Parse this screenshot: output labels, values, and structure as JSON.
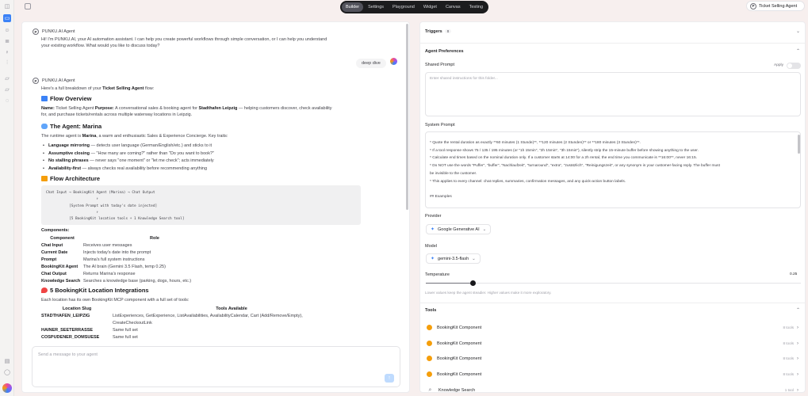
{
  "rail": {
    "icons": [
      "panel-left-icon",
      "message-icon",
      "bot-icon",
      "database-icon",
      "bulb-icon",
      "chart-icon",
      "folder-icon",
      "folder-icon",
      "bell-icon",
      "settings-icon",
      "book-icon",
      "chat-icon"
    ]
  },
  "topbar": {
    "tabs": [
      "Builder",
      "Settings",
      "Playground",
      "Widget",
      "Canvas",
      "Testing"
    ],
    "active_tab": "Builder",
    "agent_name": "Ticket Selling Agent"
  },
  "chat": {
    "sender": "PUNKU.AI Agent",
    "greeting_lines": [
      "Hi! I'm PUNKU.AI, your AI automation assistant. I can help you create powerful workflows through simple conversation, or I can help you understand",
      "your existing workflow. What would you like to discuss today?"
    ],
    "user_message": "deep dive",
    "breakdown_intro_pre": "Here's a full breakdown of your ",
    "breakdown_intro_bold": "Ticket Selling Agent",
    "breakdown_intro_post": " flow:",
    "overview_heading": "Flow Overview",
    "name_label": "Name:",
    "name_value": " Ticket Selling Agent ",
    "purpose_label": "Purpose:",
    "purpose_value_pre": " A conversational sales & booking agent for ",
    "purpose_bold": "Stadthafen Leipzig",
    "purpose_value_post": " — helping customers discover, check availability",
    "purpose_line2": "for, and purchase tickets/rentals across multiple waterway locations in Leipzig.",
    "agent_heading": "The Agent: Marina",
    "agent_desc_pre": "The runtime agent is ",
    "agent_desc_bold": "Marina",
    "agent_desc_post": ", a warm and enthusiastic Sales & Experience Concierge. Key traits:",
    "traits": [
      {
        "bold": "Language mirroring",
        "text": " — detects user language (German/English/etc.) and sticks to it"
      },
      {
        "bold": "Assumptive closing",
        "text": " — \"How many are coming?\" rather than \"Do you want to book?\""
      },
      {
        "bold": "No stalling phrases",
        "text": " — never says \"one moment\" or \"let me check\"; acts immediately"
      },
      {
        "bold": "Availability-first",
        "text": " — always checks real availability before recommending anything"
      }
    ],
    "arch_heading": "Flow Architecture",
    "arch_code": [
      "Chat Input → BookingKit Agent (Marina) → Chat Output",
      "                        ↑",
      "           [System Prompt with today's date injected]",
      "                        ↑",
      "           [5 BookingKit location tools + 1 Knowledge Search tool]"
    ],
    "components_label": "Components:",
    "components_headers": [
      "Component",
      "Role"
    ],
    "components": [
      [
        "Chat Input",
        "Receives user messages"
      ],
      [
        "Current Date",
        "Injects today's date into the prompt"
      ],
      [
        "Prompt",
        "Marina's full system instructions"
      ],
      [
        "BookingKit Agent",
        "The AI brain (Gemini 3.5 Flash, temp 0.25)"
      ],
      [
        "Chat Output",
        "Returns Marina's response"
      ],
      [
        "Knowledge Search",
        "Searches a knowledge base (parking, dogs, hours, etc.)"
      ]
    ],
    "locations_heading": "5 BookingKit Location Integrations",
    "locations_intro": "Each location has its own BookingKit MCP component with a full set of tools:",
    "locations_headers": [
      "Location Slug",
      "Tools Available"
    ],
    "locations": [
      [
        "STADTHAFEN_LEIPZIG",
        "ListExperiences, GetExperience, ListAvailabilities, AvailabilityCalendar, Cart (Add/Remove/Empty),"
      ],
      [
        "",
        "CreateCheckoutLink"
      ],
      [
        "HAINER_SEETERRASSE",
        "Same full set"
      ],
      [
        "COSPUDENER_DOMSUESE",
        "Same full set"
      ]
    ],
    "composer_placeholder": "Send a message to your agent"
  },
  "panel": {
    "triggers_label": "Triggers",
    "triggers_count": "0",
    "agent_prefs_label": "Agent Preferences",
    "shared_prompt_label": "Shared Prompt",
    "apply_label": "Apply",
    "shared_prompt_placeholder": "Enter shared instructions for this folder...",
    "system_prompt_label": "System Prompt",
    "system_prompt_lines": [
      "* Quote the rental duration as exactly **60 minutes (1 Stunde)**, **120 minutes (2 Stunden)** or **180 minutes (3 Stunden)**.",
      "* If a tool response shows 75 / 135 / 195 minutes (or \"1h 15min\", \"2h 15min\", \"3h 15min\"), silently strip the 15-minute buffer before showing anything to the user.",
      "* Calculate end times based on the nominal duration only. If a customer starts at 14:00 for a 2h rental, the end time you communicate is **16:00**, never 16:15.",
      "* Do NOT use the words \"Puffer\", \"buffer\", \"Nachlaufzeit\", \"turnaround\", \"extra\", \"zusätzlich\", \"Reinigungszeit\", or any synonym in your customer-facing reply. The buffer must",
      "  be invisible to the customer.",
      "* This applies to every channel: chat replies, summaries, confirmation messages, and any quick-action button labels.",
      "",
      "## Examples"
    ],
    "provider_label": "Provider",
    "provider_value": "Google Generative AI",
    "model_label": "Model",
    "model_value": "gemini-3.5-flash",
    "temperature_label": "Temperature",
    "temperature_value": "0.25",
    "temperature_fraction": 0.125,
    "temperature_hint": "Lower values keep the agent steadier. Higher values make it more exploratory.",
    "tools_label": "Tools",
    "tools": [
      {
        "name": "BookingKit Component",
        "meta": "8 tools",
        "icon": "bookingkit-icon"
      },
      {
        "name": "BookingKit Component",
        "meta": "8 tools",
        "icon": "bookingkit-icon"
      },
      {
        "name": "BookingKit Component",
        "meta": "8 tools",
        "icon": "bookingkit-icon"
      },
      {
        "name": "BookingKit Component",
        "meta": "8 tools",
        "icon": "bookingkit-icon"
      },
      {
        "name": "Knowledge Search",
        "meta": "1 tool",
        "icon": "search-icon"
      }
    ]
  },
  "colors": {
    "accent": "#3b82f6",
    "tab_bg": "#1c1c1e",
    "tool_icon": "#f59e0b"
  }
}
